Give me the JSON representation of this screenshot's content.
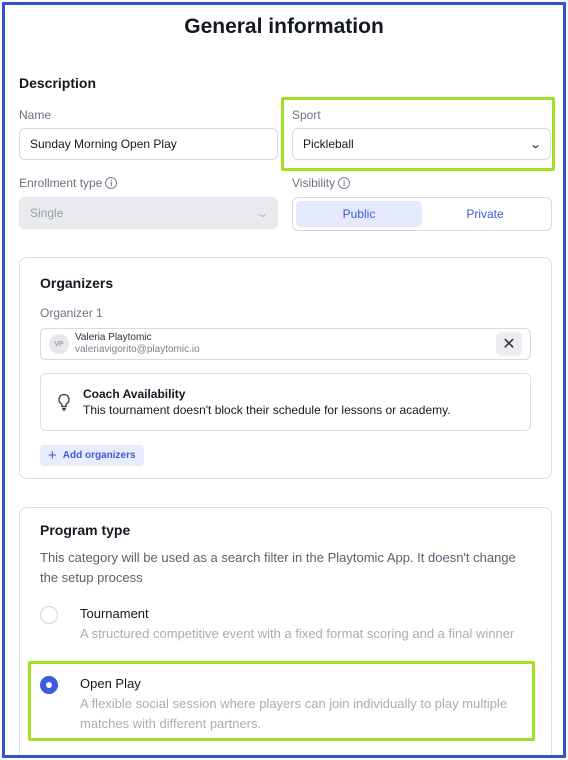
{
  "page_title": "General information",
  "description": {
    "title": "Description",
    "name": {
      "label": "Name",
      "value": "Sunday Morning Open Play"
    },
    "sport": {
      "label": "Sport",
      "value": "Pickleball"
    },
    "enrollment": {
      "label": "Enrollment type",
      "value": "Single"
    },
    "visibility": {
      "label": "Visibility",
      "options": [
        "Public",
        "Private"
      ],
      "selected": "Public"
    }
  },
  "organizers": {
    "title": "Organizers",
    "organizer_label": "Organizer 1",
    "organizer": {
      "initials": "VP",
      "name": "Valeria Playtomic",
      "email": "valeriavigorito@playtomic.io"
    },
    "coach": {
      "title": "Coach Availability",
      "description": "This tournament doesn't block their schedule for lessons or academy."
    },
    "add_label": "Add organizers"
  },
  "program": {
    "title": "Program type",
    "description": "This category will be used as a search filter in the Playtomic App. It doesn't change the setup process",
    "options": [
      {
        "title": "Tournament",
        "description": "A structured competitive event with a fixed format scoring and a final winner",
        "selected": false
      },
      {
        "title": "Open Play",
        "description": "A flexible social session where players can join individually to play multiple matches with different partners.",
        "selected": true
      }
    ]
  },
  "colors": {
    "accent": "#3b5bdb",
    "highlight": "#a2e024",
    "frame": "#2f55d4"
  }
}
